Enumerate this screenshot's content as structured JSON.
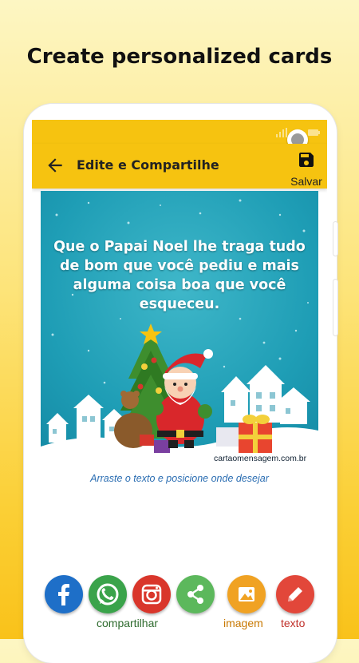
{
  "promo": {
    "headline": "Create personalized cards"
  },
  "appbar": {
    "title": "Edite e Compartilhe",
    "save_label": "Salvar"
  },
  "card": {
    "lines": [
      "Que o Papai Noel lhe traga tudo",
      "de bom que você pediu e mais",
      "alguma coisa boa que você",
      "esqueceu."
    ],
    "credit": "cartaomensagem.com.br"
  },
  "hint": "Arraste o texto e posicione onde desejar",
  "actions": {
    "share_label": "compartilhar",
    "image_label": "imagem",
    "text_label": "texto",
    "icons": [
      "facebook-icon",
      "whatsapp-icon",
      "instagram-icon",
      "share-icon",
      "image-icon",
      "pencil-icon"
    ]
  },
  "colors": {
    "appbar": "#f6c310",
    "facebook": "#1e6fc8",
    "whatsapp": "#3aa34a",
    "instagram": "#d9362b",
    "share": "#5cb85c",
    "image": "#f0a223",
    "text": "#e2473a",
    "card_bg": "#1e9db5"
  }
}
